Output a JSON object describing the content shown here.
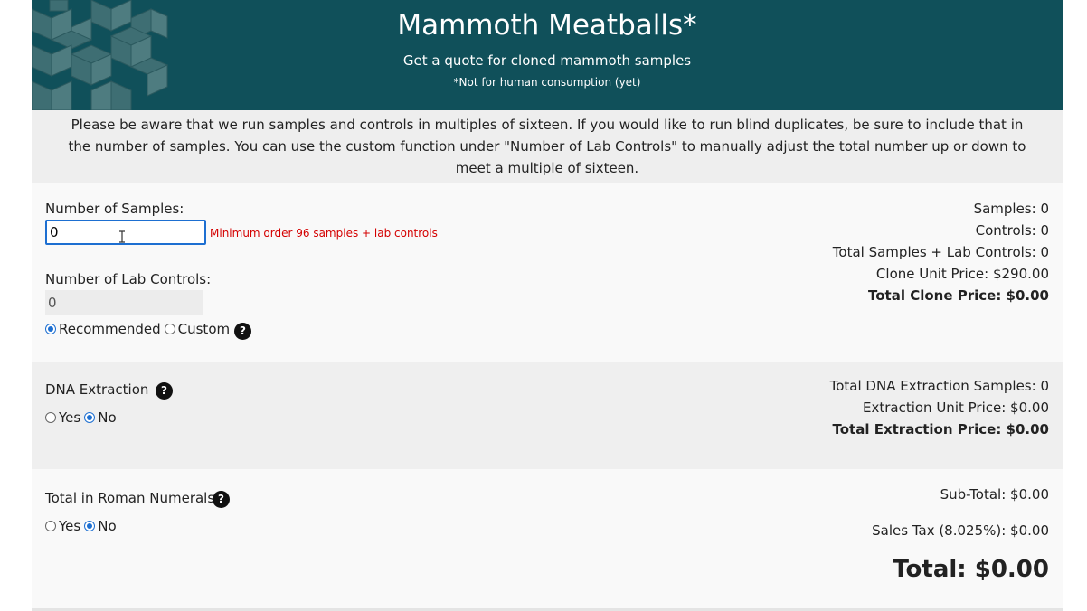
{
  "header": {
    "title": "Mammoth Meatballs*",
    "subtitle": "Get a quote for cloned mammoth samples",
    "note": "*Not for human consumption (yet)"
  },
  "notice": "Please be aware that we run samples and controls in multiples of sixteen. If you would like to run blind duplicates, be sure to include that in the number of samples. You can use the custom function under \"Number of Lab Controls\" to manually adjust the total number up or down to meet a multiple of sixteen.",
  "samples": {
    "label": "Number of Samples:",
    "value": "0",
    "error": "Minimum order 96 samples + lab controls"
  },
  "controls": {
    "label": "Number of Lab Controls:",
    "value": "0",
    "option_recommended": "Recommended",
    "option_custom": "Custom",
    "selected": "Recommended"
  },
  "summary_clone": {
    "samples": "Samples: 0",
    "controls": "Controls: 0",
    "total_samples_controls": "Total Samples + Lab Controls: 0",
    "unit_price": "Clone Unit Price: $290.00",
    "total_price": "Total Clone Price: $0.00"
  },
  "dna": {
    "label": "DNA Extraction",
    "yes": "Yes",
    "no": "No",
    "selected": "No",
    "total_samples": "Total DNA Extraction Samples: 0",
    "unit_price": "Extraction Unit Price: $0.00",
    "total_price": "Total Extraction Price: $0.00"
  },
  "roman": {
    "label": "Total in Roman Numerals",
    "yes": "Yes",
    "no": "No",
    "selected": "No"
  },
  "totals": {
    "subtotal": "Sub-Total: $0.00",
    "tax": "Sales Tax (8.025%): $0.00",
    "total": "Total: $0.00"
  },
  "help_glyph": "?",
  "colors": {
    "header_bg": "#10505a",
    "accent": "#1d6fd1",
    "error": "#d40000"
  }
}
